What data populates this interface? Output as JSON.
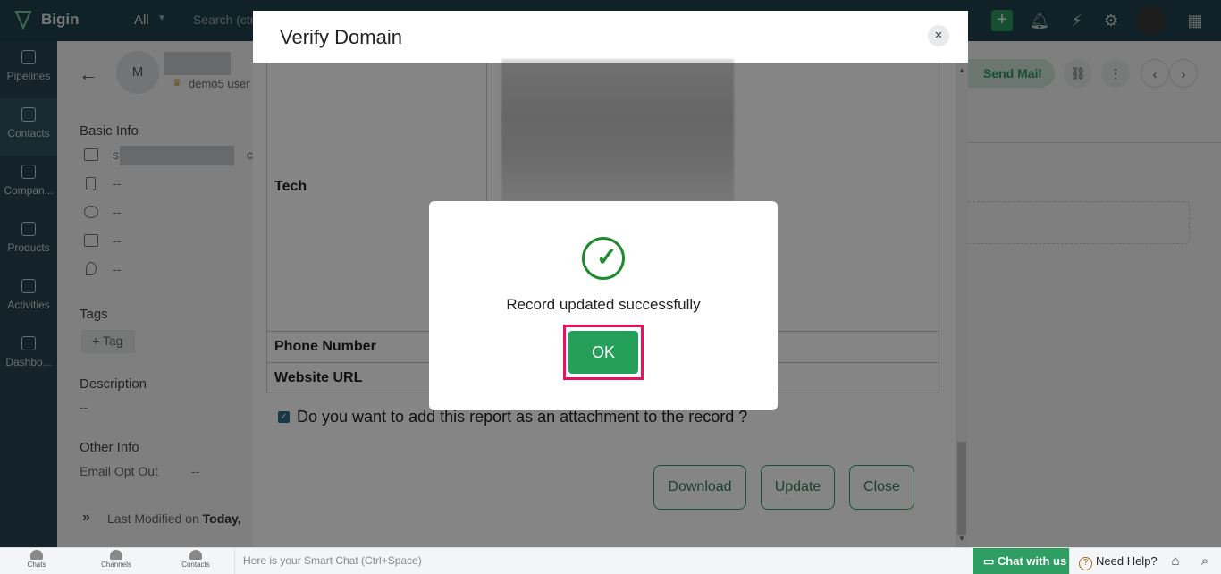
{
  "app": {
    "name": "Bigin"
  },
  "topbar": {
    "scope": "All",
    "search_placeholder": "Search (ctrl"
  },
  "nav": [
    {
      "label": "Pipelines",
      "icon": "pipelines-icon"
    },
    {
      "label": "Contacts",
      "icon": "contacts-icon"
    },
    {
      "label": "Compan...",
      "icon": "companies-icon"
    },
    {
      "label": "Products",
      "icon": "products-icon"
    },
    {
      "label": "Activities",
      "icon": "activities-icon"
    },
    {
      "label": "Dashbo...",
      "icon": "dashboards-icon"
    }
  ],
  "contact": {
    "avatar_initial": "M",
    "owner": "demo5 user",
    "basic_info_heading": "Basic Info",
    "email_prefix": "s",
    "email_suffix": "c",
    "mobile": "--",
    "phone": "--",
    "home_phone": "--",
    "address": "--",
    "tags_heading": "Tags",
    "tag_button": "+ Tag",
    "description_heading": "Description",
    "description": "--",
    "other_info_heading": "Other Info",
    "email_opt_out_label": "Email Opt Out",
    "email_opt_out_value": "--",
    "last_modified_prefix": "Last Modified on",
    "last_modified_value": "Today, "
  },
  "record_actions": {
    "send_mail": "Send Mail"
  },
  "verify_modal": {
    "title": "Verify Domain",
    "close_symbol": "×",
    "rows": [
      {
        "label": "Tech"
      },
      {
        "label": "Phone Number"
      },
      {
        "label": "Website URL"
      }
    ],
    "attach_checkbox_checked": true,
    "attach_label": "Do you want to add this report as an attachment to the record ?",
    "buttons": {
      "download": "Download",
      "update": "Update",
      "close": "Close"
    }
  },
  "success_dialog": {
    "icon": "checkmark-circle-icon",
    "message": "Record updated successfully",
    "ok": "OK",
    "highlight_color": "#e8125c"
  },
  "bottombar": {
    "items": [
      "Chats",
      "Channels",
      "Contacts"
    ],
    "smart_chat_placeholder": "Here is your Smart Chat (Ctrl+Space)",
    "chat_with_us": "Chat with us",
    "need_help": "Need Help?"
  },
  "colors": {
    "brand_green": "#2e9e63",
    "topbar": "#21434f",
    "nav": "#264652"
  }
}
